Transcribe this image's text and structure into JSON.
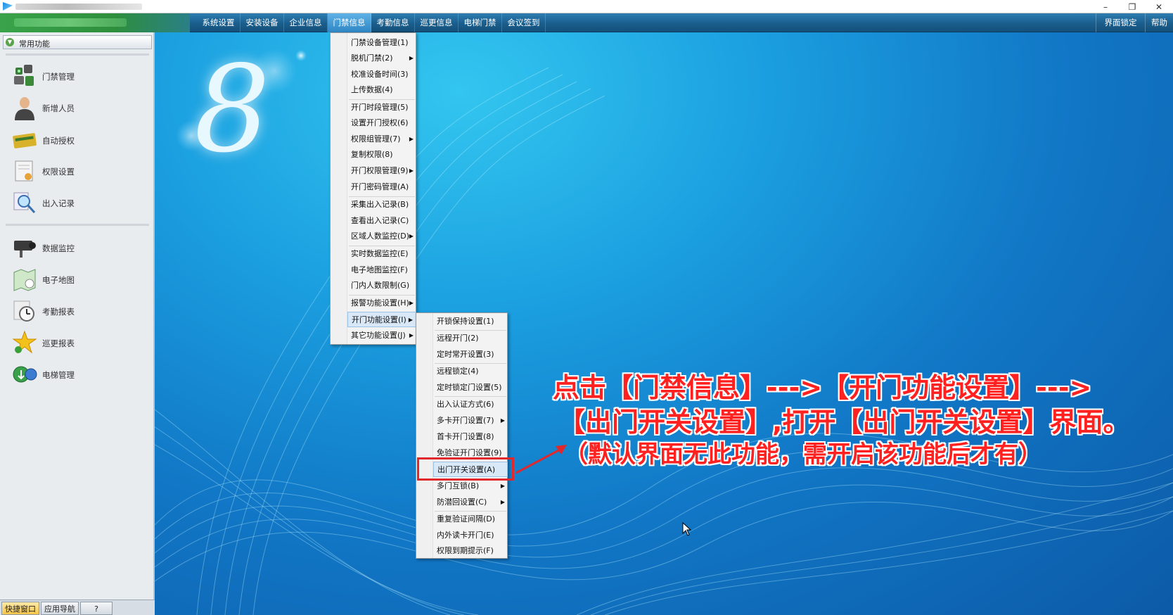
{
  "window": {
    "minimize": "–",
    "restore": "❐",
    "close": "✕"
  },
  "menubar": {
    "items": [
      "系统设置",
      "安装设备",
      "企业信息",
      "门禁信息",
      "考勤信息",
      "巡更信息",
      "电梯门禁",
      "会议签到"
    ],
    "active_index": 3,
    "right_items": [
      "界面锁定",
      "帮助"
    ]
  },
  "sidebar": {
    "header": "常用功能",
    "toggle_glyph": "▼",
    "items": [
      {
        "label": "门禁管理",
        "icon": "door-access-icon"
      },
      {
        "label": "新增人员",
        "icon": "person-icon"
      },
      {
        "label": "自动授权",
        "icon": "card-icon"
      },
      {
        "label": "权限设置",
        "icon": "permission-doc-icon"
      },
      {
        "label": "出入记录",
        "icon": "magnifier-icon"
      },
      {
        "label": "数据监控",
        "icon": "camera-icon"
      },
      {
        "label": "电子地图",
        "icon": "map-icon"
      },
      {
        "label": "考勤报表",
        "icon": "clock-icon"
      },
      {
        "label": "巡更报表",
        "icon": "star-icon"
      },
      {
        "label": "电梯管理",
        "icon": "elevator-icon"
      }
    ]
  },
  "bottom_tabs": [
    "快捷窗口",
    "应用导航",
    "?"
  ],
  "menu_main": [
    {
      "label": "门禁设备管理(1)",
      "submenu": false
    },
    {
      "label": "脱机门禁(2)",
      "submenu": true
    },
    {
      "label": "校准设备时间(3)",
      "submenu": false
    },
    {
      "label": "上传数据(4)",
      "submenu": false
    },
    {
      "label": "开门时段管理(5)",
      "submenu": false
    },
    {
      "label": "设置开门授权(6)",
      "submenu": false
    },
    {
      "label": "权限组管理(7)",
      "submenu": true
    },
    {
      "label": "复制权限(8)",
      "submenu": false
    },
    {
      "label": "开门权限管理(9)",
      "submenu": true
    },
    {
      "label": "开门密码管理(A)",
      "submenu": false
    },
    {
      "label": "采集出入记录(B)",
      "submenu": false
    },
    {
      "label": "查看出入记录(C)",
      "submenu": false
    },
    {
      "label": "区域人数监控(D)",
      "submenu": true
    },
    {
      "label": "实时数据监控(E)",
      "submenu": false
    },
    {
      "label": "电子地图监控(F)",
      "submenu": false
    },
    {
      "label": "门内人数限制(G)",
      "submenu": false
    },
    {
      "label": "报警功能设置(H)",
      "submenu": true
    },
    {
      "label": "开门功能设置(I)",
      "submenu": true
    },
    {
      "label": "其它功能设置(J)",
      "submenu": true
    }
  ],
  "menu_sub": [
    {
      "label": "开锁保持设置(1)",
      "submenu": false
    },
    {
      "label": "远程开门(2)",
      "submenu": false
    },
    {
      "label": "定时常开设置(3)",
      "submenu": false
    },
    {
      "label": "远程锁定(4)",
      "submenu": false
    },
    {
      "label": "定时锁定门设置(5)",
      "submenu": false
    },
    {
      "label": "出入认证方式(6)",
      "submenu": false
    },
    {
      "label": "多卡开门设置(7)",
      "submenu": true
    },
    {
      "label": "首卡开门设置(8)",
      "submenu": false
    },
    {
      "label": "免验证开门设置(9)",
      "submenu": false
    },
    {
      "label": "出门开关设置(A)",
      "submenu": false
    },
    {
      "label": "多门互锁(B)",
      "submenu": true
    },
    {
      "label": "防潜回设置(C)",
      "submenu": true
    },
    {
      "label": "重复验证间隔(D)",
      "submenu": false
    },
    {
      "label": "内外读卡开门(E)",
      "submenu": false
    },
    {
      "label": "权限到期提示(F)",
      "submenu": false
    }
  ],
  "annotation": {
    "line1": "点击【门禁信息】--->【开门功能设置】--->",
    "line2": "【出门开关设置】,打开【出门开关设置】界面。",
    "line3": "（默认界面无此功能，需开启该功能后才有）"
  },
  "logo_glyph": "8",
  "colors": {
    "accent_red": "#e0282d",
    "menubar": "#1a5e8d",
    "background": "#1177c6"
  }
}
